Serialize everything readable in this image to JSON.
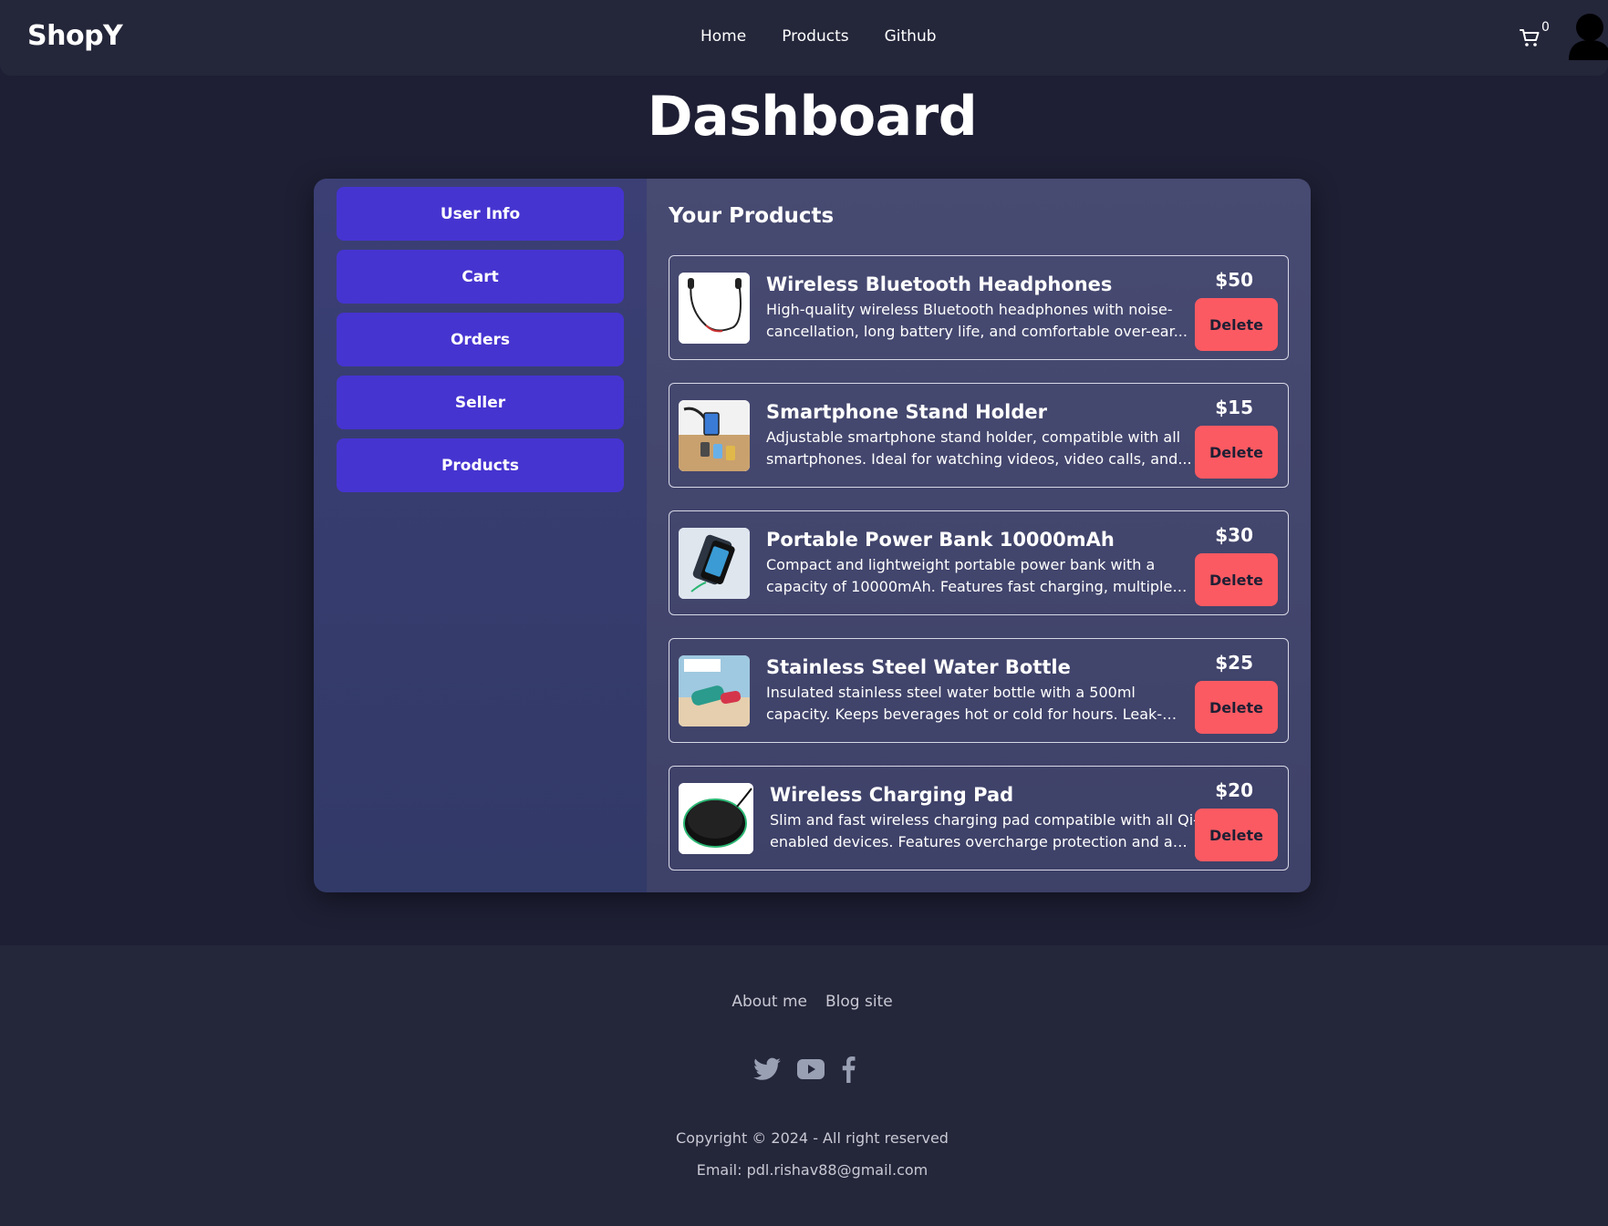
{
  "nav": {
    "brand": "ShopY",
    "links": [
      "Home",
      "Products",
      "Github"
    ],
    "cart_count": "0",
    "cart_icon": "cart-icon",
    "avatar_icon": "user-avatar-icon"
  },
  "page": {
    "title": "Dashboard"
  },
  "sidebar": {
    "items": [
      {
        "label": "User Info"
      },
      {
        "label": "Cart"
      },
      {
        "label": "Orders"
      },
      {
        "label": "Seller"
      },
      {
        "label": "Products"
      }
    ]
  },
  "main": {
    "heading": "Your Products",
    "delete_label": "Delete",
    "products": [
      {
        "name": "Wireless Bluetooth Headphones",
        "description": "High-quality wireless Bluetooth headphones with noise-cancellation, long battery life, and comfortable over-ear...",
        "price": "$50",
        "image_icon": "headphones-image"
      },
      {
        "name": "Smartphone Stand Holder",
        "description": "Adjustable smartphone stand holder, compatible with all smartphones. Ideal for watching videos, video calls, and...",
        "price": "$15",
        "image_icon": "phone-stand-image"
      },
      {
        "name": "Portable Power Bank 10000mAh",
        "description": "Compact and lightweight portable power bank with a capacity of 10000mAh. Features fast charging, multiple US...",
        "price": "$30",
        "image_icon": "power-bank-image"
      },
      {
        "name": "Stainless Steel Water Bottle",
        "description": "Insulated stainless steel water bottle with a 500ml capacity. Keeps beverages hot or cold for hours. Leak-proof and BPA...",
        "price": "$25",
        "image_icon": "water-bottle-image"
      },
      {
        "name": "Wireless Charging Pad",
        "description": "Slim and fast wireless charging pad compatible with all Qi-enabled devices. Features overcharge protection and a no...",
        "price": "$20",
        "image_icon": "charging-pad-image"
      }
    ]
  },
  "footer": {
    "links": [
      "About me",
      "Blog site"
    ],
    "social_icons": [
      "twitter-icon",
      "youtube-icon",
      "facebook-icon"
    ],
    "copyright": "Copyright © 2024 - All right reserved",
    "email": "Email: pdl.rishav88@gmail.com"
  },
  "colors": {
    "background": "#1e1f34",
    "navbar": "#24263a",
    "sidebar_button": "#4634d0",
    "delete_button": "#fb5a62"
  }
}
